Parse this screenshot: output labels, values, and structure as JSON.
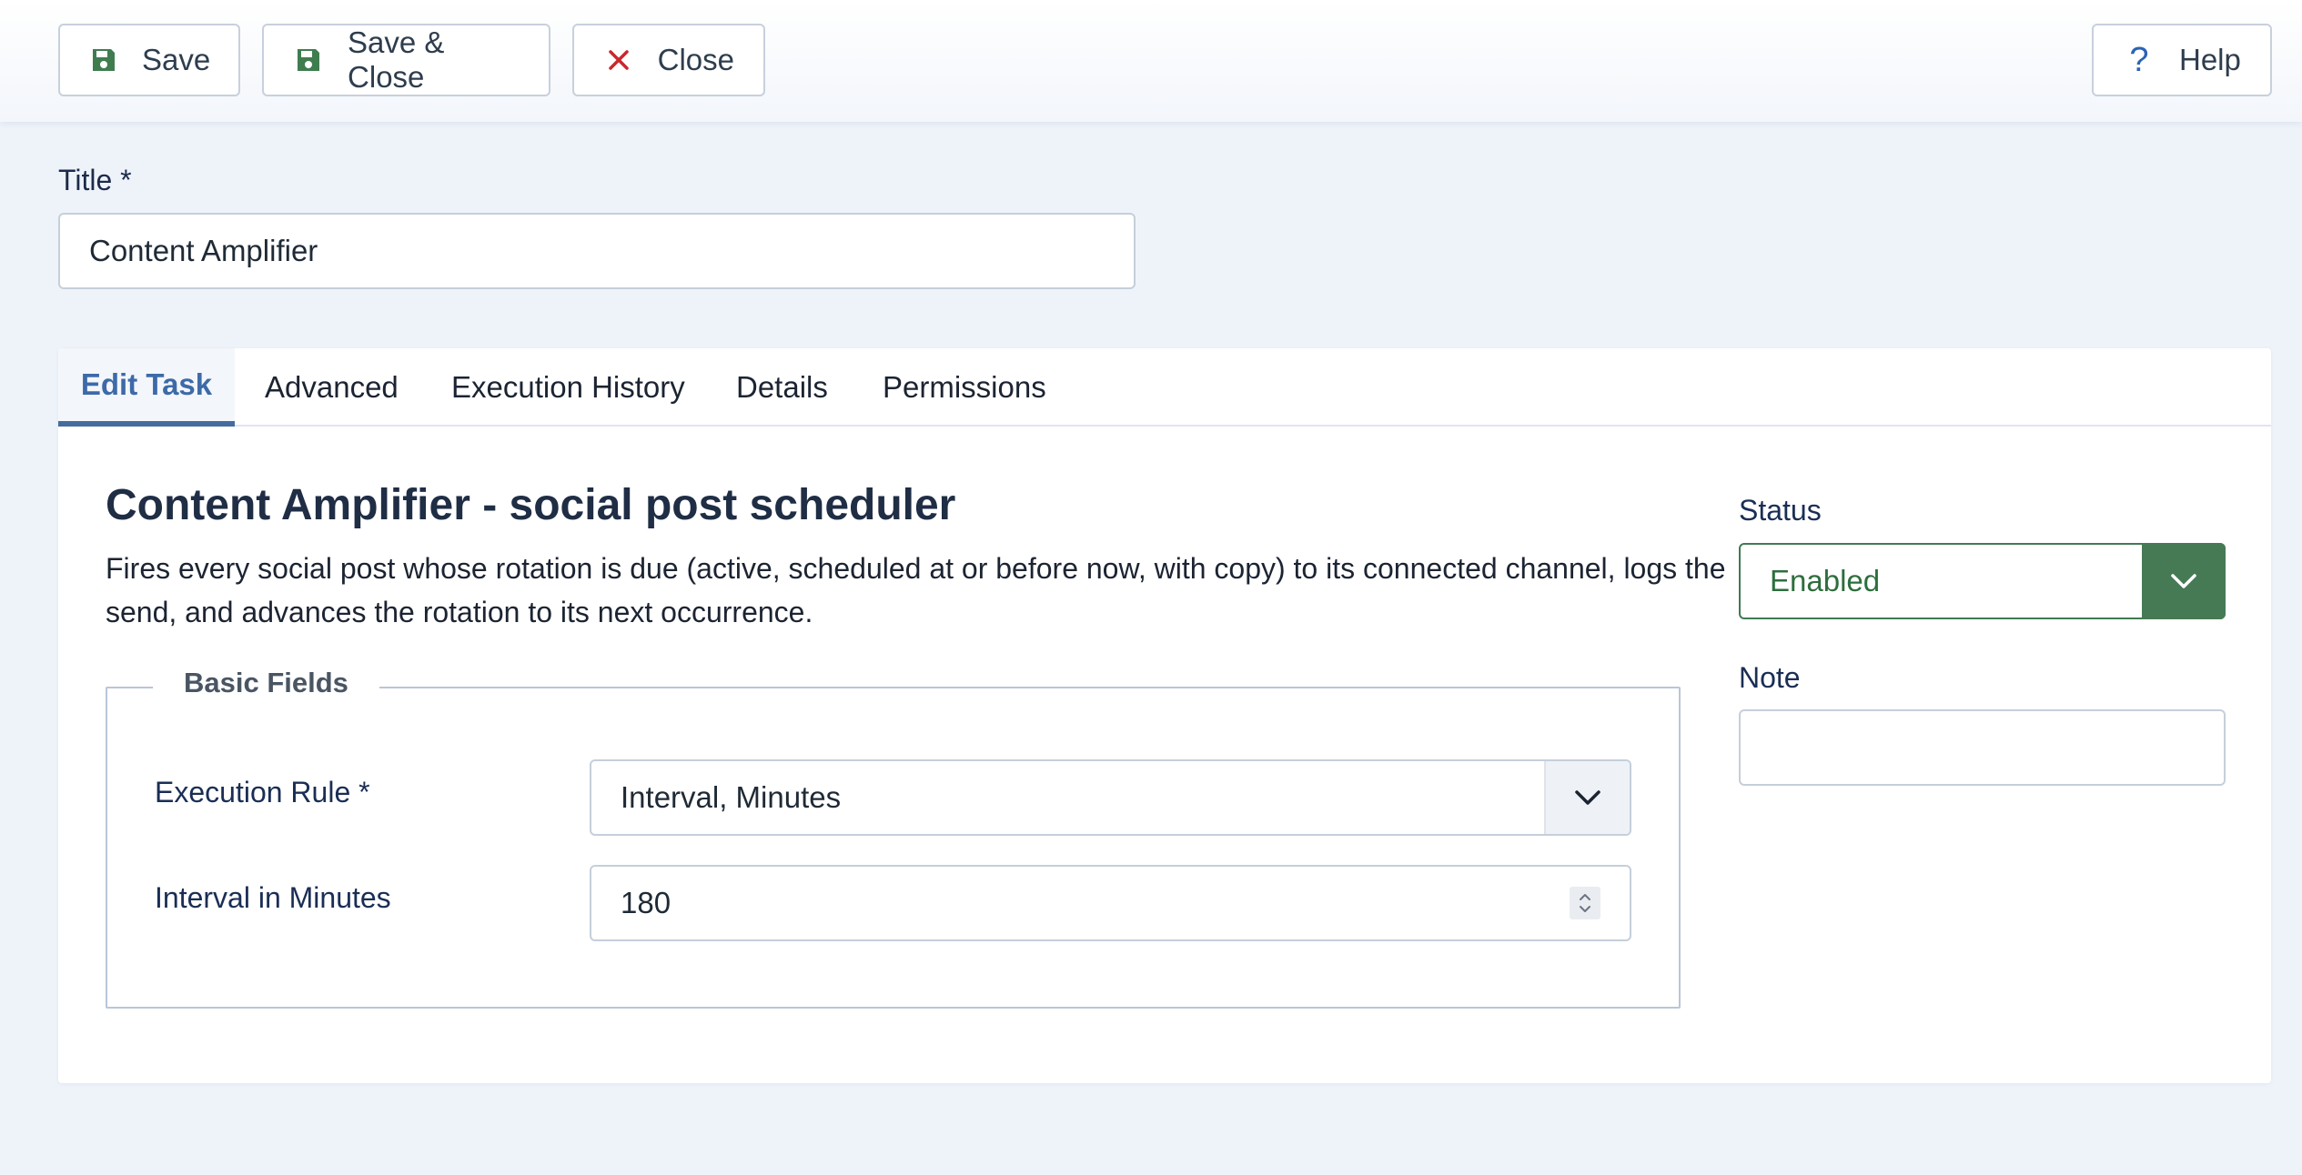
{
  "toolbar": {
    "save_label": "Save",
    "save_close_label": "Save & Close",
    "close_label": "Close",
    "help_label": "Help",
    "help_glyph": "?"
  },
  "title_field": {
    "label": "Title *",
    "value": "Content Amplifier"
  },
  "tabs": [
    {
      "label": "Edit Task",
      "active": true
    },
    {
      "label": "Advanced",
      "active": false
    },
    {
      "label": "Execution History",
      "active": false
    },
    {
      "label": "Details",
      "active": false
    },
    {
      "label": "Permissions",
      "active": false
    }
  ],
  "task": {
    "heading": "Content Amplifier - social post scheduler",
    "description": "Fires every social post whose rotation is due (active, scheduled at or before now, with copy) to its connected channel, logs the send, and advances the rotation to its next occurrence."
  },
  "basic_fields": {
    "legend": "Basic Fields",
    "execution_rule_label": "Execution Rule *",
    "execution_rule_value": "Interval, Minutes",
    "interval_label": "Interval in Minutes",
    "interval_value": "180"
  },
  "sidebar": {
    "status_label": "Status",
    "status_value": "Enabled",
    "note_label": "Note",
    "note_value": ""
  },
  "colors": {
    "save_icon": "#3f7d4f",
    "close_icon": "#c8282d",
    "help_icon": "#2a63b8",
    "status_accent": "#467a55",
    "active_tab": "#3d6aa8"
  },
  "icons": {
    "save": "floppy-disk-icon",
    "close": "x-icon",
    "help": "question-mark-icon",
    "dropdown": "chevron-down-icon",
    "spinner": "spinner-arrows-icon"
  }
}
